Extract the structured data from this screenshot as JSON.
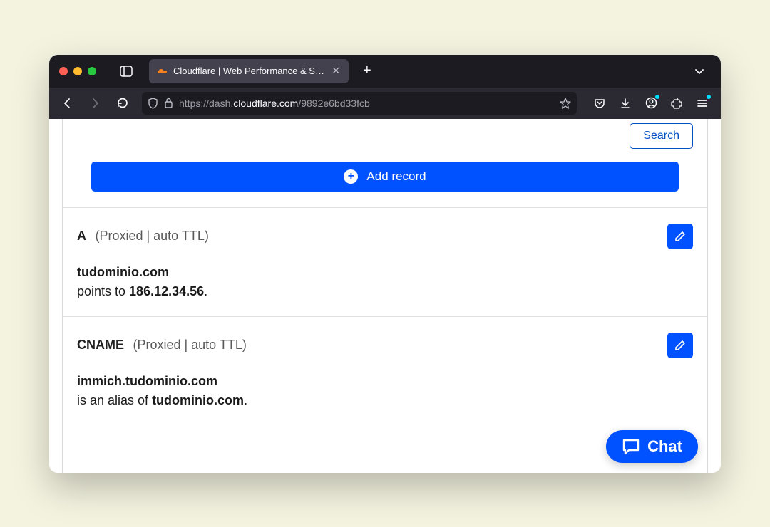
{
  "browser": {
    "tab_title": "Cloudflare | Web Performance & Security",
    "url_prefix": "https://dash.",
    "url_host": "cloudflare.com",
    "url_path": "/9892e6bd33fcb"
  },
  "actions": {
    "search": "Search",
    "add_record": "Add record",
    "chat": "Chat"
  },
  "records": [
    {
      "type": "A",
      "meta": "(Proxied | auto TTL)",
      "name": "tudominio.com",
      "desc_prefix": "points to ",
      "desc_bold": "186.12.34.56",
      "desc_suffix": "."
    },
    {
      "type": "CNAME",
      "meta": "(Proxied | auto TTL)",
      "name": "immich.tudominio.com",
      "desc_prefix": "is an alias of ",
      "desc_bold": "tudominio.com",
      "desc_suffix": "."
    }
  ]
}
